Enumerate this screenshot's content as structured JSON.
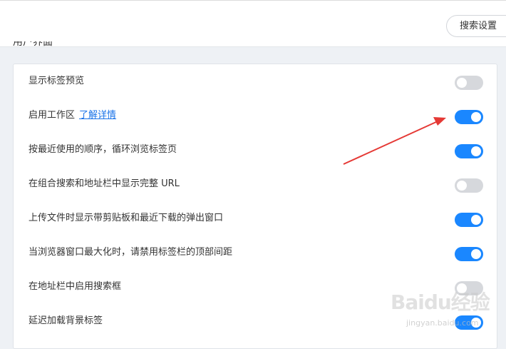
{
  "header": {
    "search_settings_label": "搜索设置"
  },
  "section": {
    "title": "用户界面"
  },
  "settings": [
    {
      "label": "显示标签预览",
      "link": "",
      "enabled": false
    },
    {
      "label": "启用工作区",
      "link": "了解详情",
      "enabled": true
    },
    {
      "label": "按最近使用的顺序，循环浏览标签页",
      "link": "",
      "enabled": true
    },
    {
      "label": "在组合搜索和地址栏中显示完整 URL",
      "link": "",
      "enabled": false
    },
    {
      "label": "上传文件时显示带剪贴板和最近下载的弹出窗口",
      "link": "",
      "enabled": true
    },
    {
      "label": "当浏览器窗口最大化时，请禁用标签栏的顶部间距",
      "link": "",
      "enabled": true
    },
    {
      "label": "在地址栏中启用搜索框",
      "link": "",
      "enabled": false
    },
    {
      "label": "延迟加载背景标签",
      "link": "",
      "enabled": true
    }
  ],
  "colors": {
    "toggle_on": "#1a87ff",
    "toggle_off": "#d6d8dc",
    "annotation_arrow": "#e53935"
  },
  "watermark": {
    "brand": "Baidu经验",
    "url": "jingyan.baidu.com"
  }
}
